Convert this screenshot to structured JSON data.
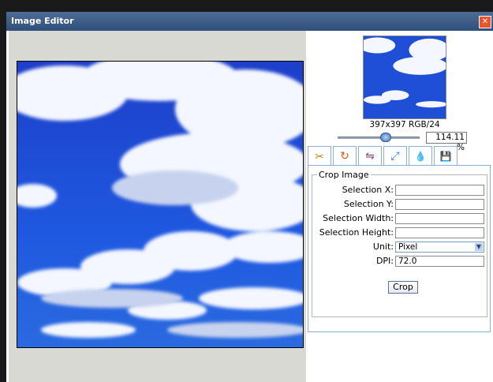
{
  "window": {
    "title": "Image Editor",
    "close_glyph": "✕"
  },
  "preview": {
    "dims": "397x397 RGB/24",
    "zoom": "114.11 %"
  },
  "tabs": [
    {
      "name": "crop",
      "icon": "crop-icon",
      "glyph": "✂"
    },
    {
      "name": "rotate",
      "icon": "rotate-icon",
      "glyph": "↻"
    },
    {
      "name": "flip",
      "icon": "flip-icon",
      "glyph": "⇋"
    },
    {
      "name": "resize",
      "icon": "resize-icon",
      "glyph": "⤢"
    },
    {
      "name": "color",
      "icon": "droplet-icon",
      "glyph": "💧"
    },
    {
      "name": "save",
      "icon": "save-icon",
      "glyph": "💾"
    }
  ],
  "crop": {
    "legend": "Crop Image",
    "fields": [
      {
        "label": "Selection X:",
        "value": ""
      },
      {
        "label": "Selection Y:",
        "value": ""
      },
      {
        "label": "Selection Width:",
        "value": ""
      },
      {
        "label": "Selection Height:",
        "value": ""
      }
    ],
    "unit_label": "Unit:",
    "unit_value": "Pixel",
    "dpi_label": "DPI:",
    "dpi_value": "72.0",
    "button": "Crop"
  },
  "colors": {
    "title_bar": "#2f4f7b",
    "sky": "#1f4fd6",
    "cloud": "#ffffff"
  }
}
